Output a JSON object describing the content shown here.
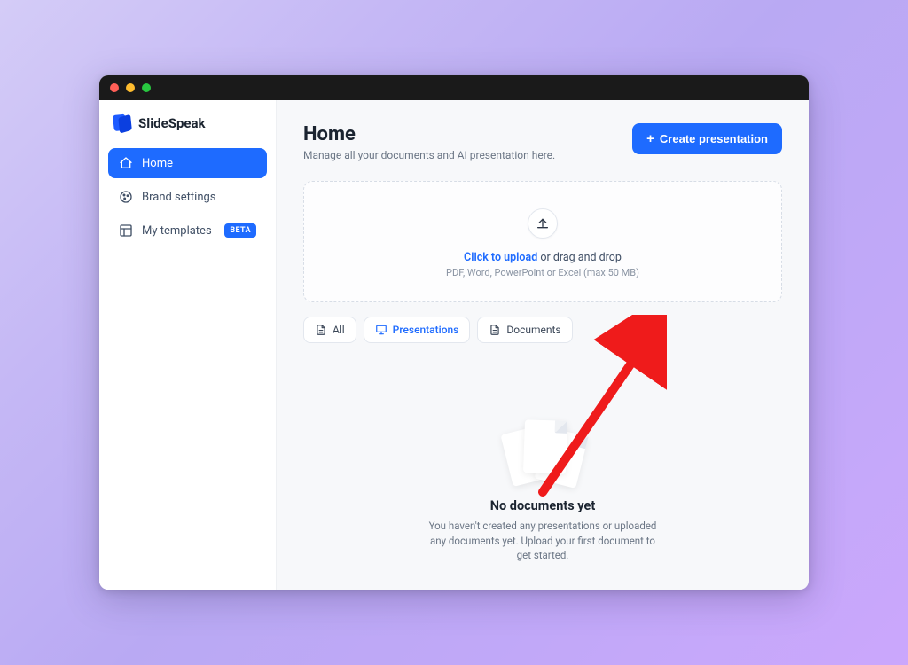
{
  "brand": "SlideSpeak",
  "sidebar": {
    "items": [
      {
        "label": "Home"
      },
      {
        "label": "Brand settings"
      },
      {
        "label": "My templates",
        "badge": "BETA"
      }
    ]
  },
  "header": {
    "title": "Home",
    "subtitle": "Manage all your documents and AI presentation here.",
    "create_label": "Create presentation"
  },
  "dropzone": {
    "link_text": "Click to upload",
    "rest_text": " or drag and drop",
    "hint": "PDF, Word, PowerPoint or Excel (max 50 MB)"
  },
  "tabs": {
    "all": "All",
    "presentations": "Presentations",
    "documents": "Documents"
  },
  "empty": {
    "title": "No documents yet",
    "desc": "You haven't created any presentations or uploaded any documents yet. Upload your first document to get started."
  }
}
